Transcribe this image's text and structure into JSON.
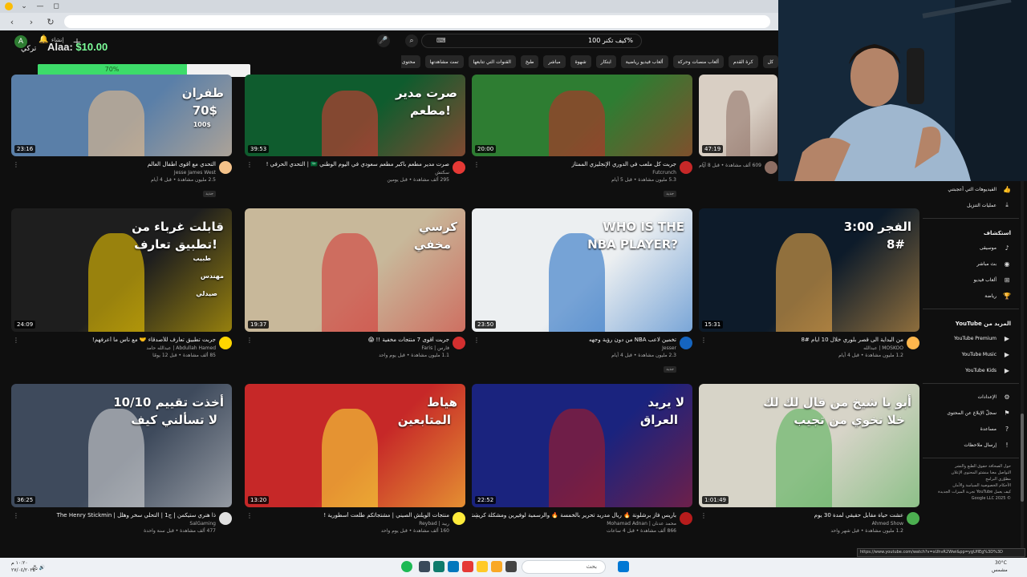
{
  "browser": {
    "tab_controls": [
      "⌄",
      "—",
      "◻"
    ],
    "nav": [
      "‹",
      "›",
      "↻"
    ]
  },
  "header": {
    "avatar_letter": "A",
    "create_label": "إنشاء",
    "search_query": "كيف تكنر 100%",
    "kbd_label": "⌨"
  },
  "donation": {
    "name": "Alaa:",
    "amount": "$10.00",
    "progress_label": "70%",
    "progress_fraction": 0.7,
    "overlay_name": "تركي"
  },
  "chips": [
    "كل",
    "كرة القدم",
    "ألعاب منصات وحركة",
    "ألعاب فيديو رياضية",
    "ابتكار",
    "شهوة",
    "مباشر",
    "طبخ",
    "القنوات التي تتابعها",
    "تمت مشاهدتها",
    "محتوى جديد"
  ],
  "videos": [
    {
      "title": "التحدي مع أقوى أطفال العالم",
      "channel": "Jesse James West",
      "meta": "2.5 مليون مشاهدة • قبل 4 أيام",
      "badge": "جديد",
      "duration": "23:16",
      "overlay": [
        "طفران",
        "70$",
        "100$"
      ],
      "bg": "#5a7fa8",
      "accent": "#f4c28a"
    },
    {
      "title": "صرت مدير مطعم بأكبر مطعم سعودي في اليوم الوطني 🇸🇦 | التحدي الحرفي !",
      "channel": "سكتش",
      "meta": "295 ألف مشاهدة • قبل يومين",
      "badge": "",
      "duration": "39:53",
      "overlay": [
        "صرت مدير",
        "مطعم!"
      ],
      "bg": "#0f5c2e",
      "accent": "#e53935"
    },
    {
      "title": "جربت كل ملعب في الدوري الإنجليزي الممتاز",
      "channel": "Futcrunch",
      "meta": "5.3 مليون مشاهدة • قبل 5 أيام",
      "badge": "جديد",
      "duration": "20:00",
      "overlay": [],
      "bg": "#2e7d32",
      "accent": "#c62828"
    },
    {
      "title": "",
      "channel": "",
      "meta": "609 ألف مشاهدة • قبل 8 أيام",
      "badge": "",
      "duration": "47:19",
      "overlay": [],
      "bg": "#d9cfc4",
      "accent": "#8d6e63"
    },
    {
      "title": "جربت تطبيق تعارف للأصدقاء 🤝 مع ناس ما أعرفهم!",
      "channel": "Abdullah Hamed | عبدالله حامد",
      "meta": "85 ألف مشاهدة • قبل 12 يومًا",
      "badge": "",
      "duration": "24:09",
      "overlay": [
        "قابلت غرباء من",
        "تطبيق تعارف!",
        "طبيب",
        "مهندس",
        "صيدلي"
      ],
      "bg": "#1e1e1e",
      "accent": "#ffd600"
    },
    {
      "title": "جربت أقوى 7 منتجات مخفية !! 😱",
      "channel": "فارس | Faris",
      "meta": "1.1 مليون مشاهدة • قبل يوم واحد",
      "badge": "",
      "duration": "19:37",
      "overlay": [
        "كرسي",
        "مخفي"
      ],
      "bg": "#c8b89a",
      "accent": "#d32f2f"
    },
    {
      "title": "تخمين لاعب NBA من دون رؤية وجهه",
      "channel": "Jesser",
      "meta": "2.3 مليون مشاهدة • قبل 4 أيام",
      "badge": "جديد",
      "duration": "23:50",
      "overlay": [
        "WHO IS THE",
        "NBA PLAYER?"
      ],
      "bg": "#eceff1",
      "accent": "#1565c0"
    },
    {
      "title": "من البداية الى قصر بلوري خلال 10 ايام #8",
      "channel": "MOSKOO | عبدالله",
      "meta": "1.2 مليون مشاهدة • قبل 4 أيام",
      "badge": "",
      "duration": "15:31",
      "overlay": [
        "3:00 الفجر",
        "8#"
      ],
      "bg": "#0d1b2a",
      "accent": "#ffb74d"
    },
    {
      "title": "ذا هنري ستيكمن | ج1 | التحلي سخر وهلل | The Henry Stickmin",
      "channel": "SalGaming",
      "meta": "477 ألف مشاهدة • قبل سنة واحدة",
      "badge": "",
      "duration": "36:25",
      "overlay": [
        "أخذت تقييم 10/10",
        "لا تسألني كيف"
      ],
      "bg": "#3e4a5c",
      "accent": "#e0e0e0"
    },
    {
      "title": "منتجات الويلش الصيني | مشتجاتكم طلعت أسطورية !",
      "channel": "ريبد | Reybad",
      "meta": "160 ألف مشاهدة • قبل يوم واحد",
      "badge": "",
      "duration": "13:20",
      "overlay": [
        "هياط",
        "المتابعين"
      ],
      "bg": "#c62828",
      "accent": "#ffeb3b"
    },
    {
      "title": "باريس فاز برشلونة 🔥 ريال مدريد تحرير بالخمسة 🔥 والرسمية لوفيرين ومشكلة كريستيانو tq",
      "channel": "محمد عدنان | Mohamad Adnan",
      "meta": "866 ألف مشاهدة • قبل 4 ساعات",
      "badge": "",
      "duration": "22:52",
      "overlay": [
        "لا يريد",
        "العراق"
      ],
      "bg": "#1a237e",
      "accent": "#b71c1c"
    },
    {
      "title": "عشت حياة مقابل حقيقي لمدة 30 يوم",
      "channel": "Ahmed Show",
      "meta": "1.2 مليون مشاهدة • قبل شهر واحد",
      "badge": "",
      "duration": "1:01:49",
      "overlay": [
        "أبو يا شيخ من قال لك لك",
        "خلا تخوي من تجيب"
      ],
      "bg": "#d7d4c8",
      "accent": "#4caf50"
    }
  ],
  "sidebar": {
    "top_items": [
      {
        "label": "الفيديوهات التي أعجبتني",
        "icon": "👍"
      },
      {
        "label": "عمليات التنزيل",
        "icon": "⤓"
      }
    ],
    "explore_heading": "استكشاف",
    "explore_items": [
      {
        "label": "موسيقى",
        "icon": "♪"
      },
      {
        "label": "بث مباشر",
        "icon": "◉"
      },
      {
        "label": "ألعاب فيديو",
        "icon": "⊞"
      },
      {
        "label": "رياضة",
        "icon": "🏆"
      }
    ],
    "more_heading": "المزيد من YouTube",
    "more_items": [
      {
        "label": "YouTube Premium",
        "icon": "▶"
      },
      {
        "label": "YouTube Music",
        "icon": "▶"
      },
      {
        "label": "YouTube Kids",
        "icon": "▶"
      }
    ],
    "settings_items": [
      {
        "label": "الإعدادات",
        "icon": "⚙"
      },
      {
        "label": "سجلّ الإبلاغ عن المحتوى",
        "icon": "⚑"
      },
      {
        "label": "مساعدة",
        "icon": "?"
      },
      {
        "label": "إرسال ملاحظات",
        "icon": "!"
      }
    ],
    "footer_lines": [
      "حول  الصحافة  حقوق الطبع والنشر",
      "التواصل معنا  منشئو المحتوى  الإعلان",
      "مطوّري البرامج",
      "الأحكام  الخصوصية  السياسة والأمان",
      "كيف يعمل YouTube  تجربة الميزات الجديدة",
      "© 2025 Google LLC"
    ]
  },
  "status_url": "https://www.youtube.com/watch?v=xUhvR2Wwi&pp=ygUfIEg%3D%3D",
  "taskbar": {
    "search_placeholder": "بحث",
    "time": "١٠:٢٠ م",
    "date": "٢٧/٠٤/٢٠٢٥",
    "weather": "30°C",
    "weather_sub": "مشمس"
  }
}
